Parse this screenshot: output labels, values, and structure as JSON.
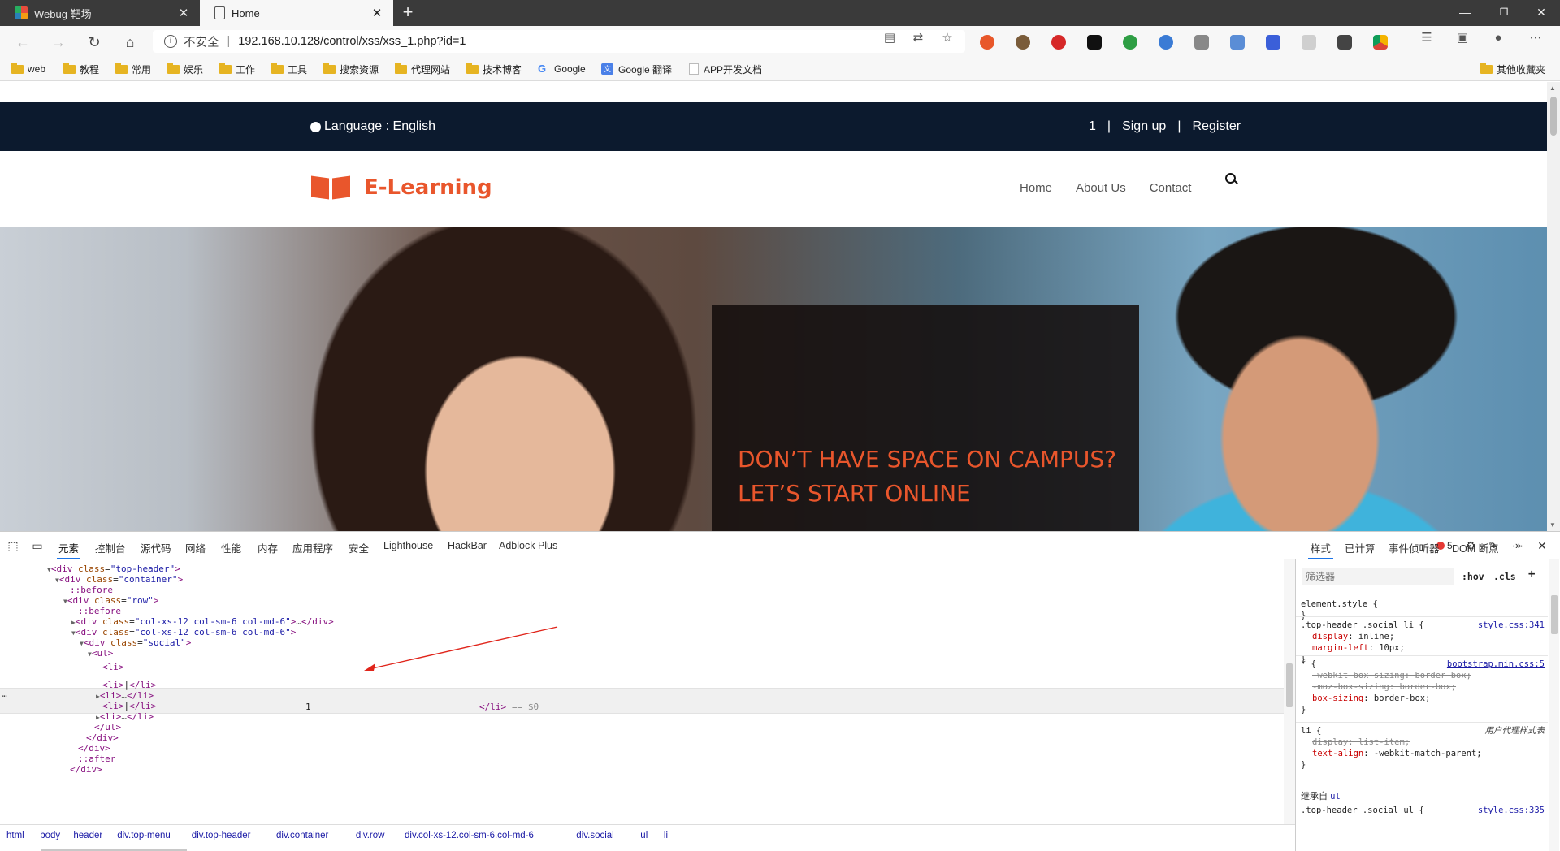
{
  "browser": {
    "tabs": [
      {
        "title": "Webug 靶场",
        "active": false
      },
      {
        "title": "Home",
        "active": true
      }
    ],
    "window_controls": [
      "—",
      "❐",
      "✕"
    ],
    "address": {
      "security_label": "不安全",
      "url": "192.168.10.128/control/xss/xss_1.php?id=1"
    },
    "bookmarks": [
      {
        "label": "web",
        "type": "folder"
      },
      {
        "label": "教程",
        "type": "folder"
      },
      {
        "label": "常用",
        "type": "folder"
      },
      {
        "label": "娱乐",
        "type": "folder"
      },
      {
        "label": "工作",
        "type": "folder"
      },
      {
        "label": "工具",
        "type": "folder"
      },
      {
        "label": "搜索资源",
        "type": "folder"
      },
      {
        "label": "代理网站",
        "type": "folder"
      },
      {
        "label": "技术博客",
        "type": "folder"
      },
      {
        "label": "Google",
        "type": "google"
      },
      {
        "label": "Google 翻译",
        "type": "translate"
      },
      {
        "label": "APP开发文档",
        "type": "doc"
      },
      {
        "label": "其他收藏夹",
        "type": "folder"
      }
    ]
  },
  "site": {
    "language": "Language : English",
    "top_links": [
      "1",
      "|",
      "Sign up",
      "|",
      "Register"
    ],
    "logo": "E-Learning",
    "menu": [
      "Home",
      "About Us",
      "Contact"
    ],
    "hero_title": "DON’T HAVE SPACE ON CAMPUS? LET’S START ONLINE",
    "brand_color": "#e9562c",
    "topbar_color": "#0c1a2e"
  },
  "devtools": {
    "tabs": [
      "元素",
      "控制台",
      "源代码",
      "网络",
      "性能",
      "内存",
      "应用程序",
      "安全",
      "Lighthouse",
      "HackBar",
      "Adblock Plus"
    ],
    "active_tab": "元素",
    "error_count": "5",
    "dom_lines": [
      {
        "text": "<div class=\"top-header\">",
        "indent": 1,
        "toggle": "▼"
      },
      {
        "text": "<div class=\"container\">",
        "indent": 2,
        "toggle": "▼"
      },
      {
        "text": "::before",
        "indent": 3,
        "toggle": ""
      },
      {
        "text": "<div class=\"row\">",
        "indent": 3,
        "toggle": "▼"
      },
      {
        "text": "::before",
        "indent": 4,
        "toggle": ""
      },
      {
        "text": "<div class=\"col-xs-12 col-sm-6 col-md-6\">…</div>",
        "indent": 4,
        "toggle": "▶"
      },
      {
        "text": "<div class=\"col-xs-12 col-sm-6 col-md-6\">",
        "indent": 4,
        "toggle": "▼"
      },
      {
        "text": "<div class=\"social\">",
        "indent": 5,
        "toggle": "▼"
      },
      {
        "text": "<ul>",
        "indent": 6,
        "toggle": "▼"
      },
      {
        "text": "<li>",
        "indent": 7,
        "toggle": ""
      },
      {
        "text": "<li>|</li>",
        "indent": 7,
        "toggle": ""
      },
      {
        "text": "<li>…</li>",
        "indent": 7,
        "toggle": "▶"
      },
      {
        "text": "<li>|</li>",
        "indent": 7,
        "toggle": ""
      },
      {
        "text": "<li>…</li>",
        "indent": 7,
        "toggle": "▶"
      },
      {
        "text": "</ul>",
        "indent": 6,
        "toggle": ""
      },
      {
        "text": "</div>",
        "indent": 5,
        "toggle": ""
      },
      {
        "text": "</div>",
        "indent": 4,
        "toggle": ""
      },
      {
        "text": "::after",
        "indent": 4,
        "toggle": ""
      },
      {
        "text": "</div>",
        "indent": 3,
        "toggle": ""
      }
    ],
    "selected_li_text": "1",
    "selected_close": "</li>",
    "selected_marker": "== $0",
    "breadcrumb": [
      "html",
      "body",
      "header",
      "div.top-menu",
      "div.top-header",
      "div.container",
      "div.row",
      "div.col-xs-12.col-sm-6.col-md-6",
      "div.social",
      "ul",
      "li"
    ],
    "styles_tabs": [
      "样式",
      "已计算",
      "事件侦听器",
      "DOM 断点"
    ],
    "filter_placeholder": "筛选器",
    "hov": ":hov",
    "cls": ".cls",
    "rules": [
      {
        "selector": "element.style {",
        "source": "",
        "props": [],
        "close": "}"
      },
      {
        "selector": ".top-header .social li {",
        "source": "style.css:341",
        "props": [
          {
            "n": "display",
            "v": "inline;",
            "strike": false
          },
          {
            "n": "margin-left",
            "v": "10px;",
            "strike": false
          }
        ],
        "close": "}"
      },
      {
        "selector": "* {",
        "source": "bootstrap.min.css:5",
        "props": [
          {
            "n": "-webkit-box-sizing",
            "v": "border-box;",
            "strike": true
          },
          {
            "n": "-moz-box-sizing",
            "v": "border-box;",
            "strike": true
          },
          {
            "n": "box-sizing",
            "v": "border-box;",
            "strike": false
          }
        ],
        "close": "}"
      },
      {
        "selector": "li {",
        "source": "用户代理样式表",
        "props": [
          {
            "n": "display",
            "v": "list-item;",
            "strike": true
          },
          {
            "n": "text-align",
            "v": "-webkit-match-parent;",
            "strike": false
          }
        ],
        "close": "}"
      }
    ],
    "inherited_label": "继承自",
    "inherited_from": "ul",
    "last_rule": {
      "selector": ".top-header .social ul {",
      "source": "style.css:335"
    }
  }
}
